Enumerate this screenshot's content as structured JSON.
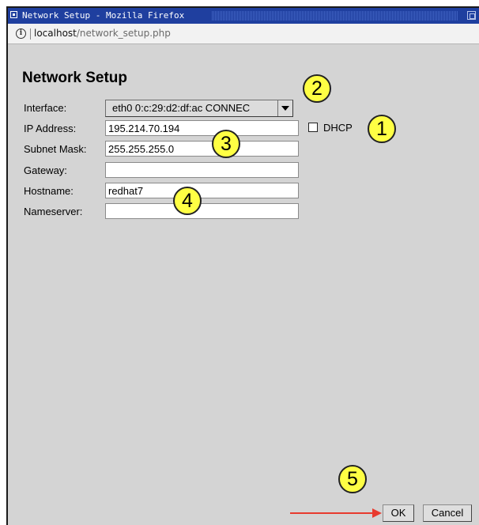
{
  "window": {
    "title": "Network Setup - Mozilla Firefox"
  },
  "urlbar": {
    "host": "localhost",
    "path": "/network_setup.php"
  },
  "page": {
    "title": "Network Setup"
  },
  "form": {
    "interface": {
      "label": "Interface:",
      "value": "eth0 0:c:29:d2:df:ac CONNEC"
    },
    "ip_address": {
      "label": "IP Address:",
      "value": "195.214.70.194"
    },
    "subnet_mask": {
      "label": "Subnet Mask:",
      "value": "255.255.255.0"
    },
    "gateway": {
      "label": "Gateway:",
      "value": ""
    },
    "hostname": {
      "label": "Hostname:",
      "value": "redhat7"
    },
    "nameserver": {
      "label": "Nameserver:",
      "value": ""
    },
    "dhcp": {
      "label": "DHCP",
      "checked": false
    }
  },
  "buttons": {
    "ok": "OK",
    "cancel": "Cancel"
  },
  "callouts": [
    "1",
    "2",
    "3",
    "4",
    "5"
  ],
  "colors": {
    "titlebar": "#1f3f9f",
    "callout": "#ffff44",
    "arrow": "#e83a2e",
    "page_background": "#d4d4d4"
  }
}
